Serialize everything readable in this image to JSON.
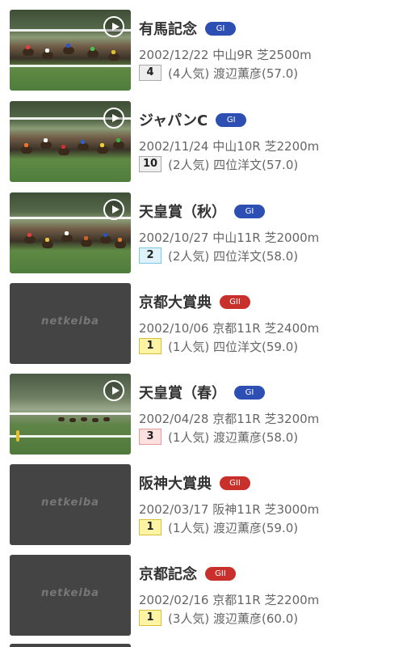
{
  "races": [
    {
      "name": "有馬記念",
      "grade": "GI",
      "grade_color": "#2d4eb3",
      "date_line": "2002/12/22 中山9R 芝2500m",
      "finish": "4",
      "finish_bg": "#eeeeee",
      "finish_border": "#aaaaaa",
      "detail": "(4人気) 渡辺薫彦(57.0)",
      "thumb": "video"
    },
    {
      "name": "ジャパンC",
      "grade": "GI",
      "grade_color": "#2d4eb3",
      "date_line": "2002/11/24 中山10R 芝2200m",
      "finish": "10",
      "finish_bg": "#eeeeee",
      "finish_border": "#aaaaaa",
      "detail": "(2人気) 四位洋文(57.0)",
      "thumb": "video"
    },
    {
      "name": "天皇賞（秋）",
      "grade": "GI",
      "grade_color": "#2d4eb3",
      "date_line": "2002/10/27 中山11R 芝2000m",
      "finish": "2",
      "finish_bg": "#dff1fb",
      "finish_border": "#7cc6e6",
      "detail": "(2人気) 四位洋文(58.0)",
      "thumb": "video"
    },
    {
      "name": "京都大賞典",
      "grade": "GII",
      "grade_color": "#c9302c",
      "date_line": "2002/10/06 京都11R 芝2400m",
      "finish": "1",
      "finish_bg": "#fff4a6",
      "finish_border": "#d8bf3a",
      "detail": "(1人気) 四位洋文(59.0)",
      "thumb": "logo",
      "logo": "netkeiba"
    },
    {
      "name": "天皇賞（春）",
      "grade": "GI",
      "grade_color": "#2d4eb3",
      "date_line": "2002/04/28 京都11R 芝3200m",
      "finish": "3",
      "finish_bg": "#fde0e0",
      "finish_border": "#e89a9a",
      "detail": "(1人気) 渡辺薫彦(58.0)",
      "thumb": "video"
    },
    {
      "name": "阪神大賞典",
      "grade": "GII",
      "grade_color": "#c9302c",
      "date_line": "2002/03/17 阪神11R 芝3000m",
      "finish": "1",
      "finish_bg": "#fff4a6",
      "finish_border": "#d8bf3a",
      "detail": "(1人気) 渡辺薫彦(59.0)",
      "thumb": "logo",
      "logo": "netkeiba"
    },
    {
      "name": "京都記念",
      "grade": "GII",
      "grade_color": "#c9302c",
      "date_line": "2002/02/16 京都11R 芝2200m",
      "finish": "1",
      "finish_bg": "#fff4a6",
      "finish_border": "#d8bf3a",
      "detail": "(3人気) 渡辺薫彦(60.0)",
      "thumb": "logo",
      "logo": "netkeiba"
    }
  ]
}
